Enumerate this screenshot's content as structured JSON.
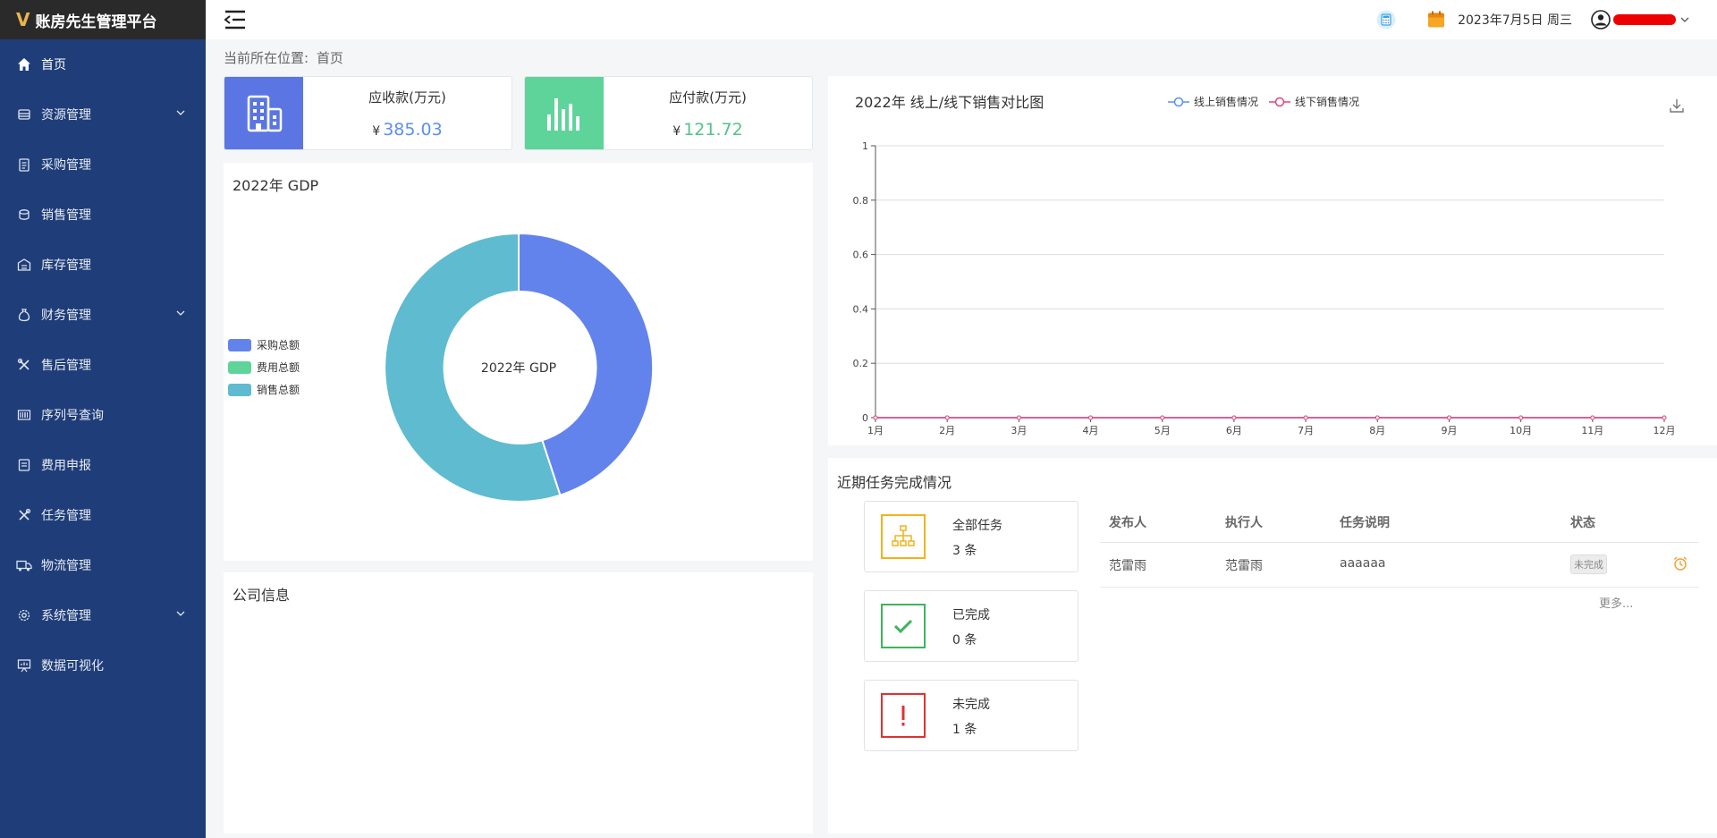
{
  "app": {
    "title": "账房先生管理平台",
    "logo_char": "V"
  },
  "sidebar": {
    "items": [
      {
        "label": "首页"
      },
      {
        "label": "资源管理"
      },
      {
        "label": "采购管理"
      },
      {
        "label": "销售管理"
      },
      {
        "label": "库存管理"
      },
      {
        "label": "财务管理"
      },
      {
        "label": "售后管理"
      },
      {
        "label": "序列号查询"
      },
      {
        "label": "费用申报"
      },
      {
        "label": "任务管理"
      },
      {
        "label": "物流管理"
      },
      {
        "label": "系统管理"
      },
      {
        "label": "数据可视化"
      }
    ]
  },
  "header": {
    "date": "2023年7月5日 周三"
  },
  "breadcrumb": {
    "prefix": "当前所在位置:",
    "current": "首页"
  },
  "stats": {
    "receivable": {
      "label": "应收款(万元)",
      "currency": "¥",
      "value": "385.03",
      "color": "#5b8ff0",
      "tile": "#5b76e3"
    },
    "payable": {
      "label": "应付款(万元)",
      "currency": "¥",
      "value": "121.72",
      "color": "#52c38a",
      "tile": "#5ed49a"
    }
  },
  "gdp": {
    "title": "2022年 GDP",
    "center": "2022年 GDP",
    "legend": [
      {
        "name": "采购总额",
        "color": "#6383ec"
      },
      {
        "name": "费用总额",
        "color": "#5ed49a"
      },
      {
        "name": "销售总额",
        "color": "#5fbbd0"
      }
    ]
  },
  "company": {
    "title": "公司信息"
  },
  "chart_data": {
    "type": "line",
    "title": "2022年 线上/线下销售对比图",
    "categories": [
      "1月",
      "2月",
      "3月",
      "4月",
      "5月",
      "6月",
      "7月",
      "8月",
      "9月",
      "10月",
      "11月",
      "12月"
    ],
    "series": [
      {
        "name": "线上销售情况",
        "color": "#5b8ff0",
        "values": [
          0,
          0,
          0,
          0,
          0,
          0,
          0,
          0,
          0,
          0,
          0,
          0
        ]
      },
      {
        "name": "线下销售情况",
        "color": "#e0457b",
        "values": [
          0,
          0,
          0,
          0,
          0,
          0,
          0,
          0,
          0,
          0,
          0,
          0
        ]
      }
    ],
    "yticks": [
      "0",
      "0.2",
      "0.4",
      "0.6",
      "0.8",
      "1"
    ],
    "ylim": [
      0,
      1
    ],
    "grid": true,
    "legend_position": "top"
  },
  "tasks": {
    "title": "近期任务完成情况",
    "cards": [
      {
        "label": "全部任务",
        "count": "3 条",
        "color": "#f2b21b"
      },
      {
        "label": "已完成",
        "count": "0 条",
        "color": "#3cb55c"
      },
      {
        "label": "未完成",
        "count": "1 条",
        "color": "#e33030"
      }
    ],
    "columns": [
      "发布人",
      "执行人",
      "任务说明",
      "状态"
    ],
    "rows": [
      {
        "publisher": "范雷雨",
        "executor": "范雷雨",
        "desc": "aaaaaa",
        "status": "未完成"
      }
    ],
    "more": "更多..."
  }
}
